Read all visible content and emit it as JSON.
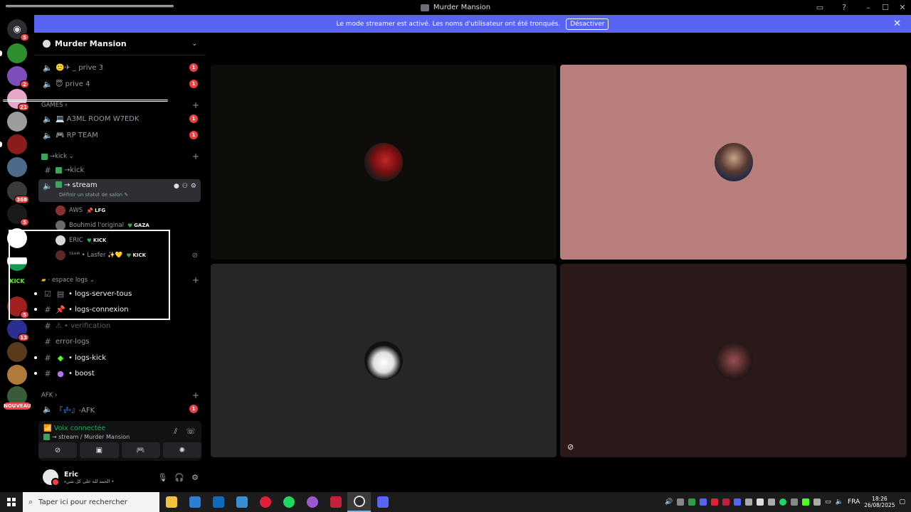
{
  "window": {
    "title": "Murder Mansion",
    "controls": [
      "inbox-icon",
      "help-icon",
      "minimize",
      "maximize",
      "close"
    ]
  },
  "banner": {
    "text": "Le mode streamer est activé. Les noms d'utilisateur ont été tronqués.",
    "button": "Désactiver",
    "close": "✕"
  },
  "server": {
    "name": "Murder Mansion",
    "chevron": "⌄"
  },
  "rail": {
    "badges": [
      "5",
      "2",
      "21",
      "368",
      "5",
      "5",
      "13"
    ],
    "kick_label": "KICK",
    "new_label": "NOUVEAU"
  },
  "channels": {
    "prive3": {
      "emoji": "🙂✈",
      "name": "_ prive 3",
      "badge": "1"
    },
    "prive4": {
      "emoji": "😇",
      "name": "prive 4",
      "badge": "1"
    },
    "cat_games": "GAMES ›",
    "a3ml": {
      "emoji": "💻",
      "name": "A3ML ROOM W7EDK",
      "badge": "1"
    },
    "rpteam": {
      "emoji": "🎮",
      "name": "RP TEAM",
      "badge": "1"
    },
    "cat_kick": "→kick ⌄",
    "kick_text": "→kick",
    "stream": {
      "name": "→ stream",
      "status": "Définir un statut de salon ✎"
    },
    "cat_logs": "· espace logs ⌄",
    "logs_server": "• logs-server-tous",
    "logs_connexion": "• logs-connexion",
    "verification": "⚠ • verification",
    "error_logs": "error-logs",
    "logs_kick": "• logs-kick",
    "boost": "• boost",
    "cat_afk": "AFK ›",
    "afk": {
      "name": "『💤』-AFK",
      "badge": "1"
    }
  },
  "voice_users": [
    {
      "name": "AWS",
      "tag": "LFG"
    },
    {
      "name": "Bouhmid l'original",
      "tag": "GAZA"
    },
    {
      "name": "ERIC",
      "tag": "KICK"
    },
    {
      "name": "ᵀᴱᴬᴹ • Lasfer ✨💛",
      "tag": "KICK"
    }
  ],
  "voice_panel": {
    "title": "Voix connectée",
    "subtitle": "→ stream / Murder Mansion"
  },
  "user": {
    "name": "Eric",
    "status": "الحمد لله على كل شيء •"
  },
  "taskbar": {
    "search_placeholder": "Taper ici pour rechercher",
    "lang": "FRA",
    "time": "18:26",
    "date": "26/08/2025"
  },
  "colors": {
    "accent": "#5865f2",
    "danger": "#f23f43",
    "online": "#23a55a",
    "tile1": "#0f0d0a",
    "tile2": "#b97f7c",
    "tile3": "#262626",
    "tile4": "#2b1818"
  }
}
